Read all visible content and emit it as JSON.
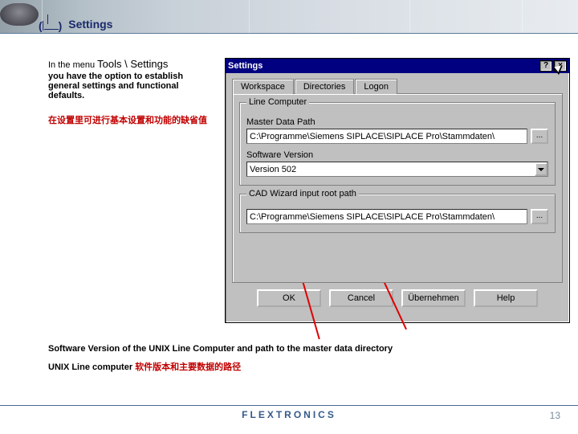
{
  "slide": {
    "title": "Settings",
    "page_number": "13",
    "footer_brand": "FLEXTRONICS"
  },
  "intro": {
    "prefix": "In the menu ",
    "menu_path": "Tools  \\ Settings",
    "body": "you have the option to establish general settings and functional defaults.",
    "red_line": "在设置里可进行基本设置和功能的缺省值"
  },
  "dialog": {
    "title": "Settings",
    "tabs": [
      "Workspace",
      "Directories",
      "Logon"
    ],
    "active_tab": 1,
    "group1": {
      "legend": "Line Computer",
      "field1_label": "Master Data Path",
      "field1_value": "C:\\Programme\\Siemens SIPLACE\\SIPLACE Pro\\Stammdaten\\",
      "field2_label": "Software Version",
      "field2_value": "Version 502"
    },
    "group2": {
      "legend": "CAD Wizard input root path",
      "field1_value": "C:\\Programme\\Siemens SIPLACE\\SIPLACE Pro\\Stammdaten\\"
    },
    "buttons": {
      "ok": "OK",
      "cancel": "Cancel",
      "apply": "Übernehmen",
      "help": "Help"
    }
  },
  "bottom": {
    "line1_black": "Software Version of the UNIX Line Computer and path to the master data directory",
    "line2_pre": "UNIX Line computer ",
    "line2_red": "软件版本和主要数据的路径"
  }
}
